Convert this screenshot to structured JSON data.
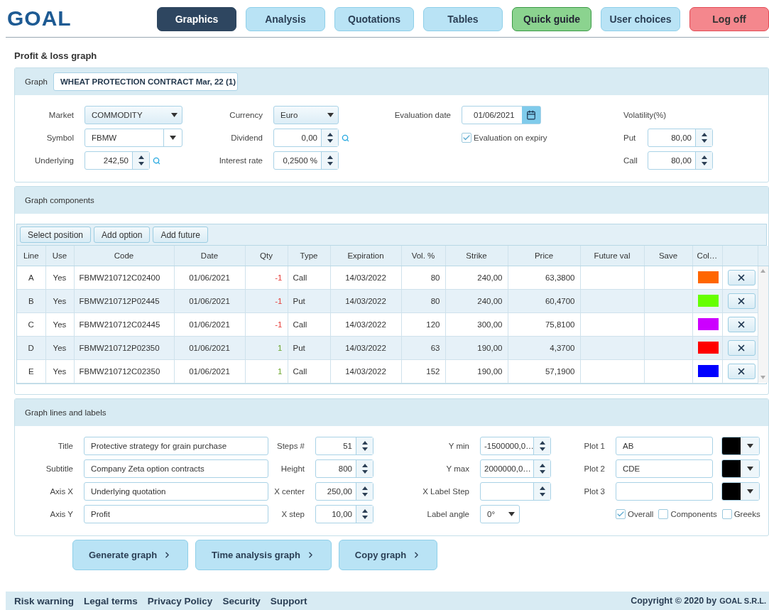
{
  "logo": "GOAL",
  "nav": [
    {
      "label": "Graphics",
      "kind": "nav",
      "selected": true
    },
    {
      "label": "Analysis",
      "kind": "nav",
      "selected": false
    },
    {
      "label": "Quotations",
      "kind": "nav",
      "selected": false
    },
    {
      "label": "Tables",
      "kind": "nav",
      "selected": false
    },
    {
      "label": "Quick guide",
      "kind": "guide",
      "selected": false
    },
    {
      "label": "User choices",
      "kind": "nav",
      "selected": false
    },
    {
      "label": "Log off",
      "kind": "logoff",
      "selected": false
    }
  ],
  "page_title": "Profit & loss graph",
  "graph": {
    "label": "Graph",
    "value": "WHEAT PROTECTION CONTRACT Mar, 22 (1)"
  },
  "params": {
    "columns": [
      [
        {
          "kind": "select",
          "label": "Market",
          "value": "COMMODITY"
        },
        {
          "kind": "combo",
          "label": "Symbol",
          "value": "FBMW"
        },
        {
          "kind": "spinner",
          "label": "Underlying",
          "value": "242,50",
          "search": true
        }
      ],
      [
        {
          "kind": "select",
          "label": "Currency",
          "value": "Euro"
        },
        {
          "kind": "spinner",
          "label": "Dividend",
          "value": "0,00",
          "search": true
        },
        {
          "kind": "spinner",
          "label": "Interest rate",
          "value": "0,2500 %"
        }
      ],
      [
        {
          "kind": "date",
          "label": "Evaluation date",
          "value": "01/06/2021"
        },
        {
          "kind": "checkbox",
          "label": "Evaluation on expiry",
          "checked": true
        }
      ],
      [
        {
          "kind": "heading",
          "label": "Volatility(%)"
        },
        {
          "kind": "spinner",
          "label": "Put",
          "value": "80,00"
        },
        {
          "kind": "spinner",
          "label": "Call",
          "value": "80,00"
        }
      ]
    ]
  },
  "components": {
    "title": "Graph components",
    "actions": [
      "Select position",
      "Add option",
      "Add future"
    ],
    "columns": [
      "Line",
      "Use",
      "Code",
      "Date",
      "Qty",
      "Type",
      "Expiration",
      "Vol. %",
      "Strike",
      "Price",
      "Future val",
      "Save",
      "Col…"
    ],
    "rows": [
      {
        "line": "A",
        "use": "Yes",
        "code": "FBMW210712C02400",
        "date": "01/06/2021",
        "qty": "-1",
        "short": true,
        "type": "Call",
        "expiration": "14/03/2022",
        "vol": "80",
        "strike": "240,00",
        "price": "63,3800",
        "color": "#ff6600"
      },
      {
        "line": "B",
        "use": "Yes",
        "code": "FBMW210712P02445",
        "date": "01/06/2021",
        "qty": "-1",
        "short": true,
        "type": "Put",
        "expiration": "14/03/2022",
        "vol": "80",
        "strike": "240,00",
        "price": "60,4700",
        "color": "#66ff00"
      },
      {
        "line": "C",
        "use": "Yes",
        "code": "FBMW210712C02445",
        "date": "01/06/2021",
        "qty": "-1",
        "short": true,
        "type": "Call",
        "expiration": "14/03/2022",
        "vol": "120",
        "strike": "300,00",
        "price": "75,8100",
        "color": "#cc00ff"
      },
      {
        "line": "D",
        "use": "Yes",
        "code": "FBMW210712P02350",
        "date": "01/06/2021",
        "qty": "1",
        "short": false,
        "type": "Put",
        "expiration": "14/03/2022",
        "vol": "63",
        "strike": "190,00",
        "price": "4,3700",
        "color": "#ff0000"
      },
      {
        "line": "E",
        "use": "Yes",
        "code": "FBMW210712C02350",
        "date": "01/06/2021",
        "qty": "1",
        "short": false,
        "type": "Call",
        "expiration": "14/03/2022",
        "vol": "152",
        "strike": "190,00",
        "price": "57,1900",
        "color": "#0000ff"
      }
    ]
  },
  "lines": {
    "title": "Graph lines and labels",
    "columns": [
      [
        {
          "kind": "text",
          "label": "Title",
          "value": "Protective strategy for grain purchase"
        },
        {
          "kind": "text",
          "label": "Subtitle",
          "value": "Company Zeta option contracts"
        },
        {
          "kind": "text",
          "label": "Axis X",
          "value": "Underlying quotation"
        },
        {
          "kind": "text",
          "label": "Axis Y",
          "value": "Profit"
        }
      ],
      [
        {
          "kind": "spinner",
          "label": "Steps #",
          "value": "51"
        },
        {
          "kind": "spinner",
          "label": "Height",
          "value": "800"
        },
        {
          "kind": "spinner",
          "label": "X center",
          "value": "250,00"
        },
        {
          "kind": "spinner",
          "label": "X step",
          "value": "10,00"
        }
      ],
      [
        {
          "kind": "spinner",
          "label": "Y min",
          "value": "-1500000,0…"
        },
        {
          "kind": "spinner",
          "label": "Y max",
          "value": "2000000,0…"
        },
        {
          "kind": "spinner",
          "label": "X Label Step"
        },
        {
          "kind": "select",
          "label": "Label angle",
          "value": "0°"
        }
      ],
      [
        {
          "kind": "plot",
          "label": "Plot 1",
          "value": "AB",
          "color": "#000000"
        },
        {
          "kind": "plot",
          "label": "Plot 2",
          "value": "CDE",
          "color": "#000000"
        },
        {
          "kind": "plot",
          "label": "Plot 3",
          "color": "#000000"
        },
        {
          "kind": "checkboxes",
          "items": [
            {
              "label": "Overall",
              "checked": true
            },
            {
              "label": "Components",
              "checked": false
            },
            {
              "label": "Greeks",
              "checked": false
            }
          ]
        }
      ]
    ]
  },
  "actions": [
    "Generate graph",
    "Time analysis graph",
    "Copy graph"
  ],
  "footer": {
    "links": [
      "Risk warning",
      "Legal terms",
      "Privacy Policy",
      "Security",
      "Support"
    ],
    "copyright": "Copyright © 2020 by",
    "company": "GOAL S.R.L."
  }
}
